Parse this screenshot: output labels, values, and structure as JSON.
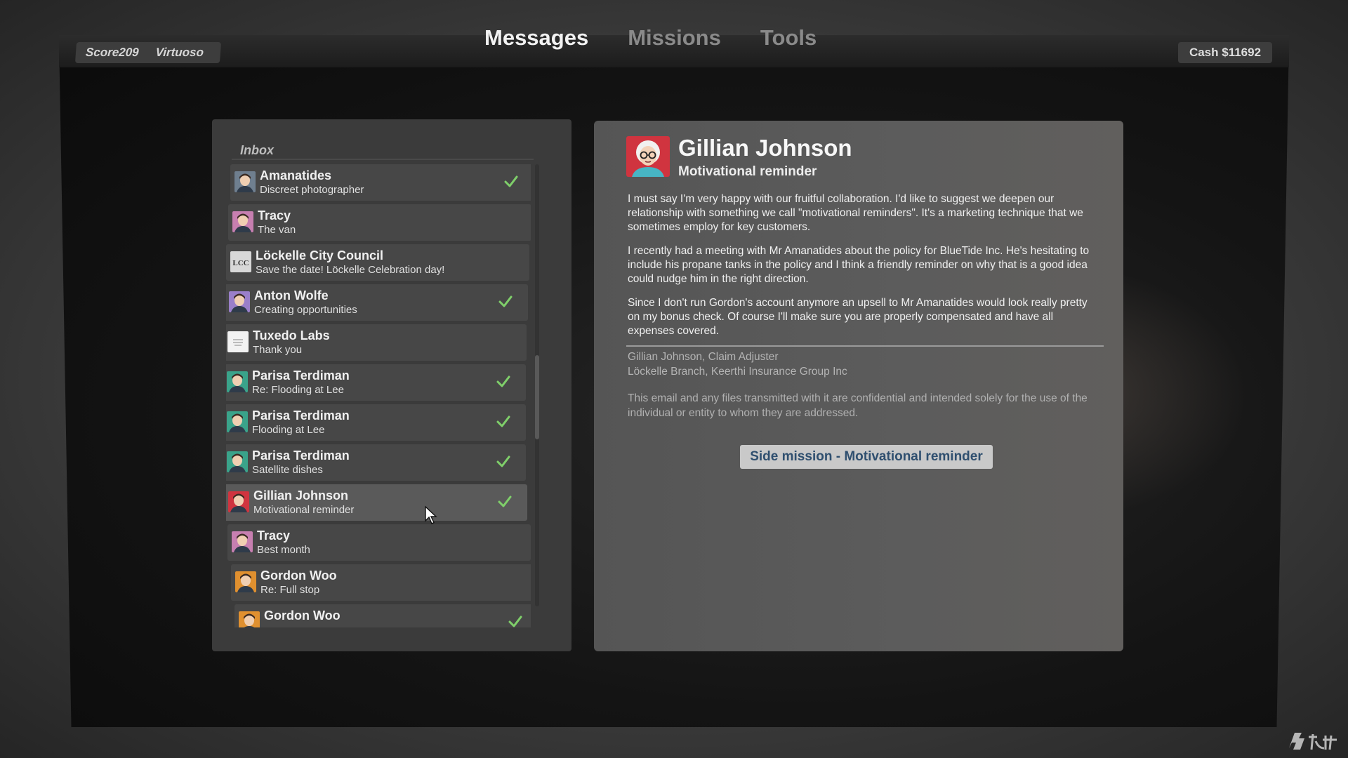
{
  "header": {
    "score_label": "Score209",
    "rank_label": "Virtuoso",
    "tabs": [
      {
        "label": "Messages",
        "active": true
      },
      {
        "label": "Missions",
        "active": false
      },
      {
        "label": "Tools",
        "active": false
      }
    ],
    "cash_label": "Cash $11692"
  },
  "inbox": {
    "title": "Inbox",
    "messages": [
      {
        "sender": "Amanatides",
        "subject": "Discreet photographer",
        "read_check": true,
        "avatar": "man-portrait-icon",
        "avatar_color": "#6f7f8f"
      },
      {
        "sender": "Tracy",
        "subject": "The van",
        "read_check": false,
        "avatar": "woman-portrait-icon",
        "avatar_color": "#c77fb0"
      },
      {
        "sender": "Löckelle City Council",
        "subject": "Save the date! Löckelle Celebration day!",
        "read_check": false,
        "avatar": "lcc-logo-icon",
        "avatar_color": "#d8d8d8"
      },
      {
        "sender": "Anton Wolfe",
        "subject": "Creating opportunities",
        "read_check": true,
        "avatar": "man-portrait-icon",
        "avatar_color": "#9a7fc9"
      },
      {
        "sender": "Tuxedo Labs",
        "subject": "Thank you",
        "read_check": false,
        "avatar": "tuxedo-labs-logo-icon",
        "avatar_color": "#f2f2f2"
      },
      {
        "sender": "Parisa Terdiman",
        "subject": "Re: Flooding at Lee",
        "read_check": true,
        "avatar": "woman-portrait-icon",
        "avatar_color": "#3aa38a"
      },
      {
        "sender": "Parisa Terdiman",
        "subject": "Flooding at Lee",
        "read_check": true,
        "avatar": "woman-portrait-icon",
        "avatar_color": "#3aa38a"
      },
      {
        "sender": "Parisa Terdiman",
        "subject": "Satellite dishes",
        "read_check": true,
        "avatar": "woman-portrait-icon",
        "avatar_color": "#3aa38a"
      },
      {
        "sender": "Gillian Johnson",
        "subject": "Motivational reminder",
        "read_check": true,
        "selected": true,
        "avatar": "woman-portrait-icon",
        "avatar_color": "#d0343f"
      },
      {
        "sender": "Tracy",
        "subject": "Best month",
        "read_check": false,
        "avatar": "woman-portrait-icon",
        "avatar_color": "#c77fb0"
      },
      {
        "sender": "Gordon Woo",
        "subject": "Re: Full stop",
        "read_check": false,
        "avatar": "man-portrait-icon",
        "avatar_color": "#e0902f"
      },
      {
        "sender": "Gordon Woo",
        "subject": "",
        "read_check": true,
        "avatar": "man-portrait-icon",
        "avatar_color": "#e0902f"
      }
    ]
  },
  "message": {
    "sender": "Gillian Johnson",
    "subject": "Motivational reminder",
    "avatar_color": "#d0343f",
    "paragraphs": [
      "I must say I'm very happy with our fruitful collaboration. I'd like to suggest we deepen our relationship with something we call \"motivational reminders\". It's a marketing technique that we sometimes employ for key customers.",
      "I recently had a meeting with Mr Amanatides about the policy for BlueTide Inc. He's hesitating to include his propane tanks in the policy and I think a friendly reminder on why that is a good idea could nudge him in the right direction.",
      "Since I don't run Gordon's account anymore an upsell to Mr Amanatides would look really pretty on my bonus check. Of course I'll make sure you are properly compensated and have all expenses covered."
    ],
    "signature_line1": "Gillian Johnson, Claim Adjuster",
    "signature_line2": "Löckelle Branch, Keerthi Insurance Group Inc",
    "disclaimer": "This email and any files transmitted with it are confidential and intended solely for the use of the individual or entity to whom they are addressed.",
    "mission_button": "Side mission - Motivational reminder"
  },
  "colors": {
    "check_green": "#7fcf6a",
    "mission_text": "#2f4f6f",
    "panel_bg": "#3b3b3b",
    "row_bg": "#474747"
  }
}
